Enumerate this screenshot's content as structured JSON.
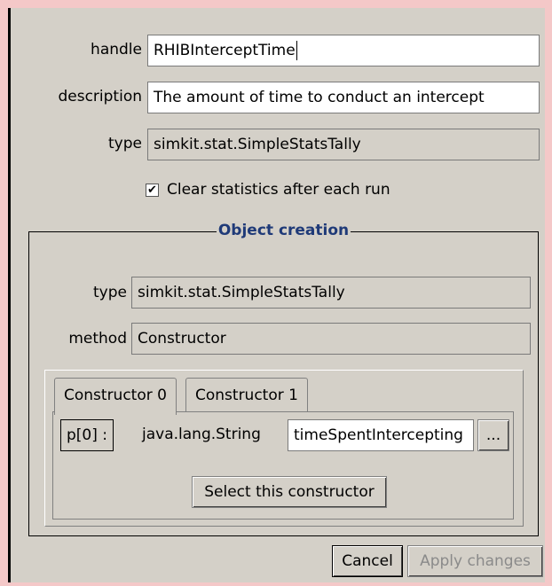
{
  "form": {
    "handle_label": "handle",
    "handle_value": "RHIBInterceptTime",
    "description_label": "description",
    "description_value": "The amount of time to conduct an intercept",
    "type_label": "type",
    "type_value": "simkit.stat.SimpleStatsTally",
    "clear_stats_checked": true,
    "clear_stats_label": "Clear statistics after each run"
  },
  "object_creation": {
    "title": "Object creation",
    "type_label": "type",
    "type_value": "simkit.stat.SimpleStatsTally",
    "method_label": "method",
    "method_value": "Constructor",
    "tabs": [
      {
        "label": "Constructor 0",
        "active": true
      },
      {
        "label": "Constructor 1",
        "active": false
      }
    ],
    "param_tag": "p[0] :",
    "param_type": "java.lang.String",
    "param_value": "timeSpentIntercepting",
    "browse_label": "...",
    "select_button": "Select this constructor"
  },
  "buttons": {
    "cancel": "Cancel",
    "apply": "Apply changes"
  }
}
